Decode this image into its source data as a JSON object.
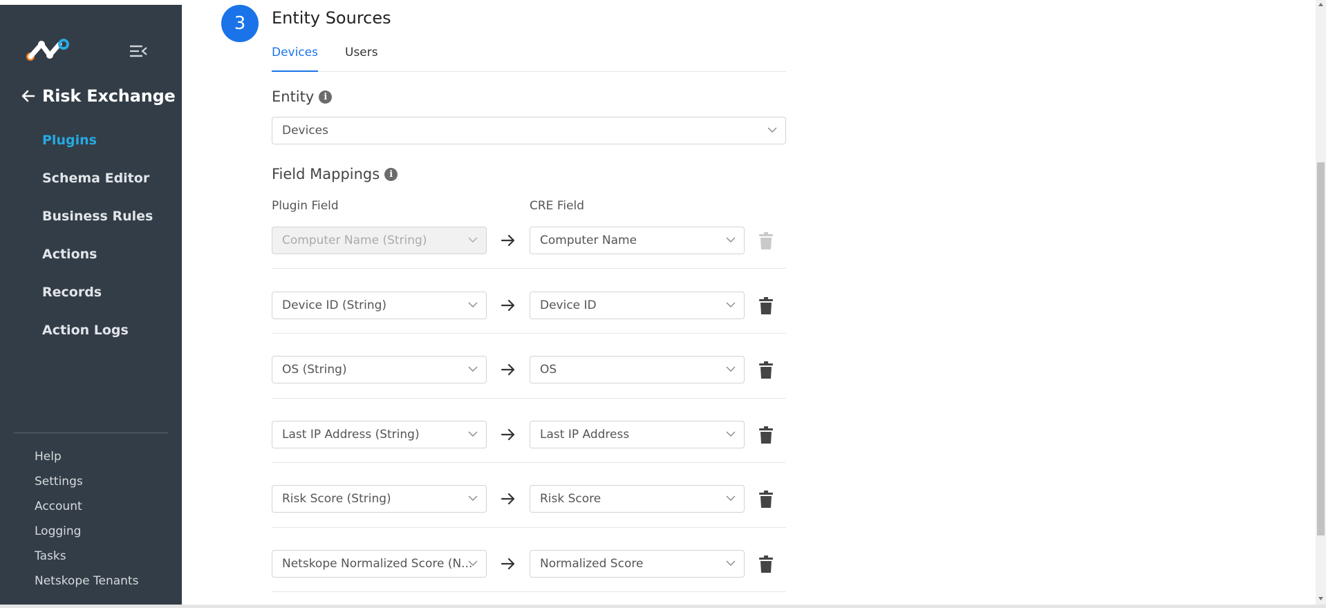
{
  "sidebar": {
    "back_title": "Risk Exchange",
    "nav_items": [
      {
        "label": "Plugins",
        "active": true
      },
      {
        "label": "Schema Editor",
        "active": false
      },
      {
        "label": "Business Rules",
        "active": false
      },
      {
        "label": "Actions",
        "active": false
      },
      {
        "label": "Records",
        "active": false
      },
      {
        "label": "Action Logs",
        "active": false
      }
    ],
    "bottom_items": [
      {
        "label": "Help"
      },
      {
        "label": "Settings"
      },
      {
        "label": "Account"
      },
      {
        "label": "Logging"
      },
      {
        "label": "Tasks"
      },
      {
        "label": "Netskope Tenants"
      }
    ],
    "active_color": "#27a9e1",
    "background_color": "#333d47"
  },
  "main": {
    "step_number": "3",
    "section_title": "Entity Sources",
    "tabs": [
      {
        "label": "Devices",
        "active": true
      },
      {
        "label": "Users",
        "active": false
      }
    ],
    "entity_label": "Entity",
    "entity_value": "Devices",
    "field_mappings_label": "Field Mappings",
    "plugin_field_header": "Plugin Field",
    "cre_field_header": "CRE Field",
    "mappings": [
      {
        "plugin_field": "Computer Name (String)",
        "cre_field": "Computer Name",
        "disabled": true
      },
      {
        "plugin_field": "Device ID (String)",
        "cre_field": "Device ID",
        "disabled": false
      },
      {
        "plugin_field": "OS (String)",
        "cre_field": "OS",
        "disabled": false
      },
      {
        "plugin_field": "Last IP Address (String)",
        "cre_field": "Last IP Address",
        "disabled": false
      },
      {
        "plugin_field": "Risk Score (String)",
        "cre_field": "Risk Score",
        "disabled": false
      },
      {
        "plugin_field": "Netskope Normalized Score (N...",
        "cre_field": "Normalized Score",
        "disabled": false
      }
    ],
    "accent_color": "#1a73e8"
  },
  "icons": {
    "logo": "netskope-logo-icon",
    "collapse": "menu-collapse-icon",
    "back": "arrow-left-icon",
    "info": "info-icon",
    "chevron": "chevron-down-icon",
    "arrow": "arrow-right-icon",
    "trash": "trash-icon"
  }
}
